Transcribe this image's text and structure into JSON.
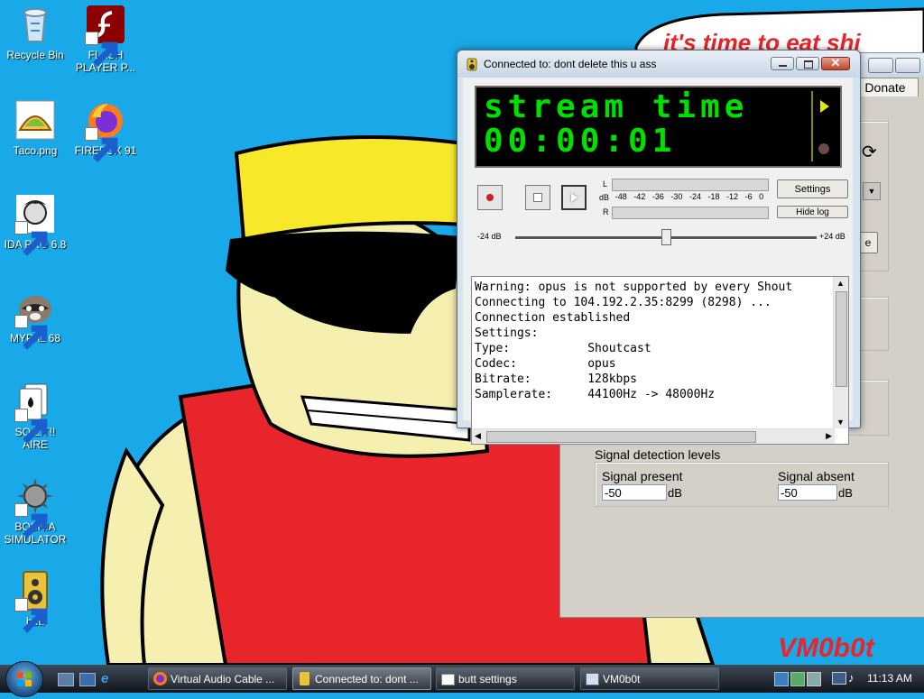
{
  "desktop": {
    "icons": [
      {
        "label": "Recycle Bin"
      },
      {
        "label": "FLASH PLAYER P..."
      },
      {
        "label": "Taco.png"
      },
      {
        "label": "FIREFOX 91"
      },
      {
        "label": "IDA PRO 6.8"
      },
      {
        "label": "MYPAL 68"
      },
      {
        "label": "SO LIT!! AIRE"
      },
      {
        "label": "BOSNIA SIMULATOR"
      },
      {
        "label": "butt"
      }
    ],
    "wallpaper_text": {
      "top": "it's time to eat shi",
      "signature": "VM0b0t"
    },
    "colors": {
      "sky": "#19a9e8",
      "skin": "#f5efb0",
      "shirt": "#e8252a",
      "hat": "#f7e82a"
    }
  },
  "settings_window": {
    "donate_label": "Donate",
    "signal_detection": {
      "title": "Signal detection levels",
      "present_label": "Signal present",
      "present_value": "-50",
      "present_unit": "dB",
      "absent_label": "Signal absent",
      "absent_value": "-50",
      "absent_unit": "dB"
    }
  },
  "main_window": {
    "title": "Connected to: dont delete this u ass",
    "lcd": {
      "line1": "stream time",
      "line2": "00:00:01"
    },
    "vu": {
      "l": "L",
      "db": "dB",
      "r": "R",
      "scale": [
        "-48",
        "-42",
        "-36",
        "-30",
        "-24",
        "-18",
        "-12",
        "-6",
        "0"
      ]
    },
    "settings_button": "Settings",
    "hide_log_button": "Hide log",
    "gain": {
      "min": "-24 dB",
      "max": "+24 dB",
      "value": 0
    },
    "log": [
      "Warning: opus is not supported by every Shout",
      "Connecting to 104.192.2.35:8299 (8298) ...",
      "Connection established",
      "Settings:",
      "Type:           Shoutcast",
      "Codec:          opus",
      "Bitrate:        128kbps",
      "Samplerate:     44100Hz -> 48000Hz"
    ]
  },
  "taskbar": {
    "buttons": [
      {
        "label": "Virtual Audio Cable ..."
      },
      {
        "label": "Connected to: dont ..."
      },
      {
        "label": "butt settings"
      },
      {
        "label": "VM0b0t"
      }
    ],
    "clock": "11:13 AM"
  }
}
